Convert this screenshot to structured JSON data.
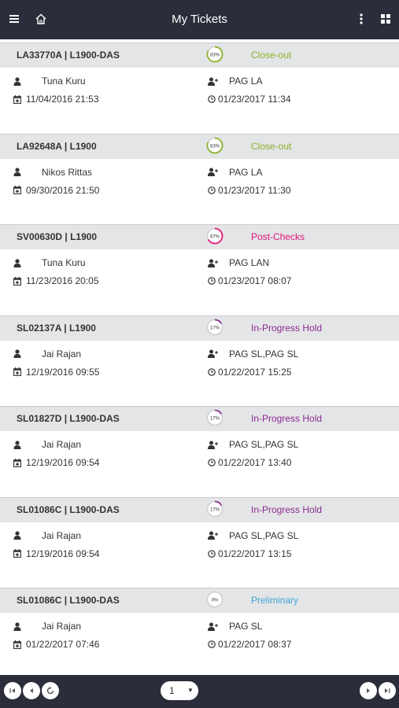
{
  "header": {
    "title": "My Tickets"
  },
  "colors": {
    "close_out": "#8ab32a",
    "post_checks": "#e0157a",
    "in_progress_hold": "#8b2a8f",
    "preliminary": "#3ea5d6"
  },
  "tickets": [
    {
      "id": "LA33770A | L1900-DAS",
      "percent": "83%",
      "progress": 0.83,
      "status": "Close-out",
      "status_color": "#8ab32a",
      "user": "Tuna Kuru",
      "group": "PAG LA",
      "created": "11/04/2016 21:53",
      "updated": "01/23/2017 11:34"
    },
    {
      "id": "LA92648A | L1900",
      "percent": "83%",
      "progress": 0.83,
      "status": "Close-out",
      "status_color": "#8ab32a",
      "user": "Nikos Rittas",
      "group": "PAG LA",
      "created": "09/30/2016 21:50",
      "updated": "01/23/2017 11:30"
    },
    {
      "id": "SV00630D | L1900",
      "percent": "67%",
      "progress": 0.67,
      "status": "Post-Checks",
      "status_color": "#e0157a",
      "user": "Tuna Kuru",
      "group": "PAG LAN",
      "created": "11/23/2016 20:05",
      "updated": "01/23/2017 08:07"
    },
    {
      "id": "SL02137A | L1900",
      "percent": "17%",
      "progress": 0.17,
      "status": "In-Progress Hold",
      "status_color": "#8b2a8f",
      "user": "Jai Rajan",
      "group": "PAG SL,PAG SL",
      "created": "12/19/2016 09:55",
      "updated": "01/22/2017 15:25"
    },
    {
      "id": "SL01827D | L1900-DAS",
      "percent": "17%",
      "progress": 0.17,
      "status": "In-Progress Hold",
      "status_color": "#8b2a8f",
      "user": "Jai Rajan",
      "group": "PAG SL,PAG SL",
      "created": "12/19/2016 09:54",
      "updated": "01/22/2017 13:40"
    },
    {
      "id": "SL01086C | L1900-DAS",
      "percent": "17%",
      "progress": 0.17,
      "status": "In-Progress Hold",
      "status_color": "#8b2a8f",
      "user": "Jai Rajan",
      "group": "PAG SL,PAG SL",
      "created": "12/19/2016 09:54",
      "updated": "01/22/2017 13:15"
    },
    {
      "id": "SL01086C | L1900-DAS",
      "percent": "0%",
      "progress": 0,
      "status": "Preliminary",
      "status_color": "#3ea5d6",
      "user": "Jai Rajan",
      "group": "PAG SL",
      "created": "01/22/2017 07:46",
      "updated": "01/22/2017 08:37"
    }
  ],
  "pagination": {
    "current_page": "1"
  }
}
